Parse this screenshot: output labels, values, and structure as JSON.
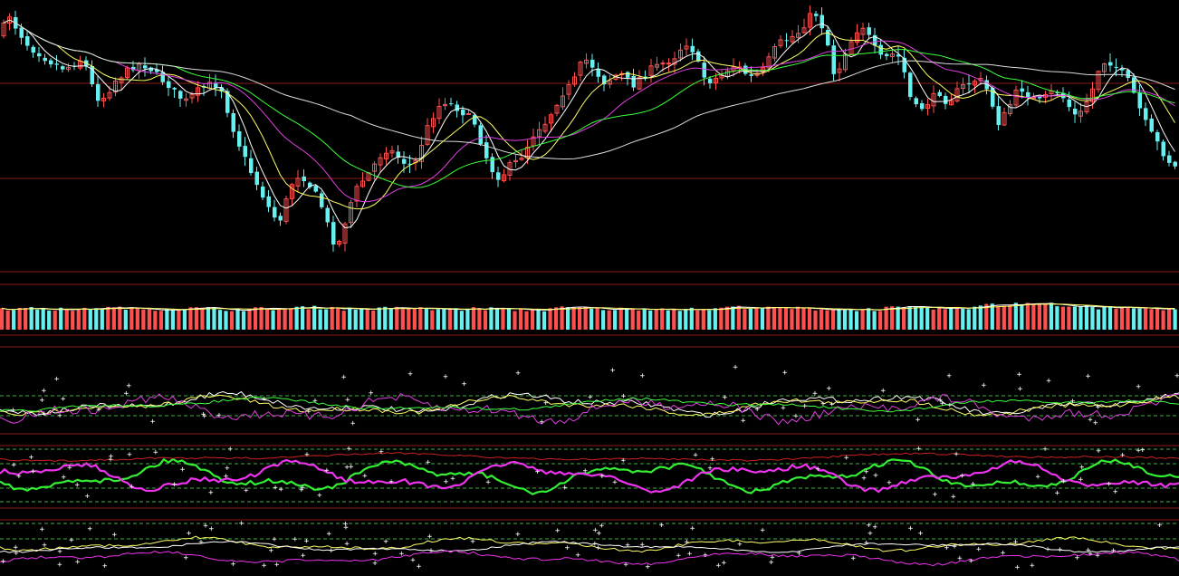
{
  "chart_data": {
    "type": "candlestick",
    "title": "",
    "colors": {
      "background": "#000000",
      "up": "#ff5050",
      "down": "#66f0f0",
      "divider": "#8b1a1a",
      "dashed": "#3cb043",
      "ma5": "#ffffff",
      "ma10": "#ffff66",
      "ma20": "#e040e0",
      "ma30": "#3cff3c",
      "ma60": "#dcdcdc",
      "osc_green": "#33ee33",
      "osc_magenta": "#ee33ee",
      "osc_red": "#cc2222",
      "markers": "#ffffff"
    },
    "price_path": [
      [
        0,
        38
      ],
      [
        6,
        12
      ],
      [
        14,
        28
      ],
      [
        22,
        40
      ],
      [
        30,
        52
      ],
      [
        40,
        58
      ],
      [
        50,
        66
      ],
      [
        60,
        72
      ],
      [
        70,
        76
      ],
      [
        80,
        70
      ],
      [
        90,
        64
      ],
      [
        100,
        96
      ],
      [
        108,
        112
      ],
      [
        116,
        104
      ],
      [
        124,
        90
      ],
      [
        134,
        82
      ],
      [
        144,
        74
      ],
      [
        154,
        70
      ],
      [
        164,
        76
      ],
      [
        174,
        86
      ],
      [
        184,
        94
      ],
      [
        194,
        106
      ],
      [
        204,
        112
      ],
      [
        214,
        102
      ],
      [
        224,
        96
      ],
      [
        234,
        92
      ],
      [
        244,
        100
      ],
      [
        250,
        126
      ],
      [
        258,
        150
      ],
      [
        266,
        170
      ],
      [
        274,
        188
      ],
      [
        282,
        204
      ],
      [
        290,
        220
      ],
      [
        298,
        236
      ],
      [
        306,
        246
      ],
      [
        314,
        222
      ],
      [
        322,
        198
      ],
      [
        330,
        192
      ],
      [
        338,
        202
      ],
      [
        346,
        214
      ],
      [
        354,
        230
      ],
      [
        362,
        256
      ],
      [
        370,
        276
      ],
      [
        378,
        248
      ],
      [
        386,
        222
      ],
      [
        394,
        204
      ],
      [
        402,
        196
      ],
      [
        410,
        184
      ],
      [
        418,
        172
      ],
      [
        426,
        164
      ],
      [
        434,
        170
      ],
      [
        442,
        178
      ],
      [
        450,
        182
      ],
      [
        458,
        178
      ],
      [
        466,
        150
      ],
      [
        474,
        132
      ],
      [
        482,
        118
      ],
      [
        490,
        112
      ],
      [
        498,
        116
      ],
      [
        506,
        122
      ],
      [
        514,
        128
      ],
      [
        522,
        136
      ],
      [
        530,
        160
      ],
      [
        538,
        182
      ],
      [
        546,
        196
      ],
      [
        554,
        192
      ],
      [
        562,
        182
      ],
      [
        570,
        178
      ],
      [
        578,
        166
      ],
      [
        586,
        150
      ],
      [
        594,
        140
      ],
      [
        602,
        134
      ],
      [
        610,
        118
      ],
      [
        618,
        104
      ],
      [
        626,
        96
      ],
      [
        634,
        86
      ],
      [
        642,
        64
      ],
      [
        650,
        70
      ],
      [
        658,
        82
      ],
      [
        666,
        92
      ],
      [
        674,
        86
      ],
      [
        682,
        80
      ],
      [
        690,
        88
      ],
      [
        698,
        94
      ],
      [
        706,
        84
      ],
      [
        714,
        78
      ],
      [
        722,
        74
      ],
      [
        730,
        70
      ],
      [
        738,
        66
      ],
      [
        746,
        60
      ],
      [
        754,
        46
      ],
      [
        762,
        54
      ],
      [
        770,
        74
      ],
      [
        778,
        90
      ],
      [
        786,
        88
      ],
      [
        794,
        84
      ],
      [
        802,
        76
      ],
      [
        810,
        72
      ],
      [
        818,
        78
      ],
      [
        826,
        86
      ],
      [
        834,
        82
      ],
      [
        842,
        76
      ],
      [
        850,
        60
      ],
      [
        858,
        48
      ],
      [
        866,
        44
      ],
      [
        874,
        40
      ],
      [
        882,
        34
      ],
      [
        890,
        20
      ],
      [
        898,
        14
      ],
      [
        906,
        30
      ],
      [
        914,
        56
      ],
      [
        920,
        88
      ],
      [
        926,
        72
      ],
      [
        934,
        50
      ],
      [
        942,
        40
      ],
      [
        948,
        24
      ],
      [
        956,
        38
      ],
      [
        964,
        54
      ],
      [
        972,
        66
      ],
      [
        980,
        62
      ],
      [
        988,
        58
      ],
      [
        996,
        78
      ],
      [
        1004,
        112
      ],
      [
        1012,
        122
      ],
      [
        1020,
        116
      ],
      [
        1028,
        108
      ],
      [
        1036,
        102
      ],
      [
        1044,
        114
      ],
      [
        1052,
        104
      ],
      [
        1060,
        96
      ],
      [
        1068,
        92
      ],
      [
        1076,
        88
      ],
      [
        1084,
        90
      ],
      [
        1092,
        110
      ],
      [
        1100,
        136
      ],
      [
        1108,
        126
      ],
      [
        1116,
        110
      ],
      [
        1124,
        96
      ],
      [
        1132,
        104
      ],
      [
        1140,
        110
      ],
      [
        1148,
        112
      ],
      [
        1156,
        104
      ],
      [
        1164,
        100
      ],
      [
        1172,
        108
      ],
      [
        1180,
        120
      ],
      [
        1188,
        132
      ],
      [
        1196,
        116
      ],
      [
        1204,
        100
      ],
      [
        1212,
        74
      ],
      [
        1220,
        66
      ],
      [
        1228,
        72
      ],
      [
        1236,
        80
      ],
      [
        1244,
        90
      ],
      [
        1252,
        108
      ],
      [
        1260,
        130
      ],
      [
        1268,
        146
      ],
      [
        1276,
        158
      ],
      [
        1284,
        172
      ],
      [
        1292,
        182
      ],
      [
        1300,
        188
      ]
    ],
    "volume_pattern": [
      0.9,
      0.8,
      1,
      0.85,
      0.95,
      0.8,
      0.9,
      1.05,
      0.85,
      0.95,
      0.8,
      0.9,
      0.75,
      1,
      0.85,
      0.9,
      0.8,
      1.1,
      0.95,
      0.85,
      0.8,
      1,
      0.9,
      1.4,
      1.7,
      1.2,
      1,
      0.9
    ],
    "legend": []
  }
}
